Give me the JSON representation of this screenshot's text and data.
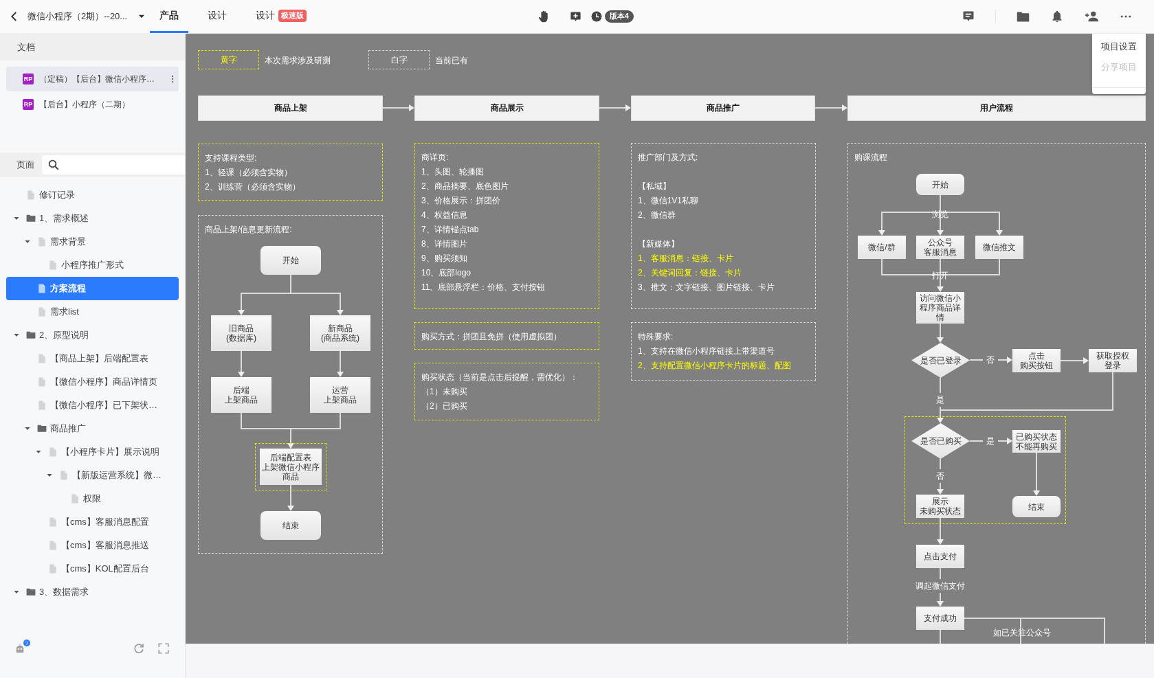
{
  "topbar": {
    "project": "微信小程序（2期）--20...",
    "tabs": [
      {
        "label": "产品",
        "selected": true
      },
      {
        "label": "设计",
        "selected": false
      },
      {
        "label": "设计",
        "selected": false,
        "badge": "极速版"
      }
    ],
    "version": "版本4"
  },
  "menu": [
    {
      "label": "项目设置",
      "disabled": false
    },
    {
      "label": "分享项目",
      "disabled": true
    }
  ],
  "sidebar": {
    "docs_title": "文档",
    "docs": [
      {
        "badge": "RP",
        "label": "（定稿）【后台】微信小程序…",
        "selected": true
      },
      {
        "badge": "RP",
        "label": "【后台】小程序（二期）",
        "selected": false
      }
    ],
    "pages_title": "页面",
    "tree": [
      {
        "kind": "page",
        "label": "修订记录",
        "selected": false
      },
      {
        "kind": "folder",
        "label": "1、需求概述",
        "selected": false,
        "expanded": true,
        "children": [
          {
            "kind": "page",
            "label": "需求背景",
            "selected": false,
            "expanded": true,
            "children": [
              {
                "kind": "page",
                "label": "小程序推广形式",
                "selected": false
              }
            ]
          },
          {
            "kind": "page",
            "label": "方案流程",
            "selected": true
          },
          {
            "kind": "page",
            "label": "需求list",
            "selected": false
          }
        ]
      },
      {
        "kind": "folder",
        "label": "2、原型说明",
        "selected": false,
        "expanded": true,
        "children": [
          {
            "kind": "page",
            "label": "【商品上架】后端配置表",
            "selected": false
          },
          {
            "kind": "page",
            "label": "【微信小程序】商品详情页",
            "selected": false
          },
          {
            "kind": "page",
            "label": "【微信小程序】已下架状…",
            "selected": false
          },
          {
            "kind": "folder",
            "label": "商品推广",
            "selected": false,
            "expanded": true,
            "children": [
              {
                "kind": "page",
                "label": "【小程序卡片】展示说明",
                "selected": false,
                "expanded": true,
                "children": [
                  {
                    "kind": "page",
                    "label": "【新版运营系统】微…",
                    "selected": false,
                    "expanded": true,
                    "children": [
                      {
                        "kind": "page",
                        "label": "权限",
                        "selected": false
                      }
                    ]
                  }
                ]
              },
              {
                "kind": "page",
                "label": "【cms】客服消息配置",
                "selected": false
              },
              {
                "kind": "page",
                "label": "【cms】客服消息推送",
                "selected": false
              },
              {
                "kind": "page",
                "label": "【cms】KOL配置后台",
                "selected": false
              }
            ]
          }
        ]
      },
      {
        "kind": "folder",
        "label": "3、数据需求",
        "selected": false,
        "expanded": true
      }
    ],
    "help_badge": "?"
  },
  "canvas": {
    "legend": [
      {
        "label": "黄字",
        "highlighted": true,
        "text": "本次需求涉及研测"
      },
      {
        "label": "白字",
        "highlighted": false,
        "text": "当前已有"
      }
    ],
    "columns": [
      {
        "header": "商品上架",
        "notes": [
          {
            "highlighted": true,
            "title": "支持课程类型:",
            "lines": [
              {
                "text": "1、轻课（必须含实物）",
                "highlighted": false
              },
              {
                "text": "2、训练营（必须含实物）",
                "highlighted": false
              }
            ]
          },
          {
            "highlighted": false,
            "title": "商品上架/信息更新流程:",
            "flow": {
              "nodes": [
                {
                  "kind": "terminal",
                  "label": "开始"
                },
                {
                  "kind": "process",
                  "lines": [
                    "旧商品",
                    "(数据库)"
                  ]
                },
                {
                  "kind": "process",
                  "lines": [
                    "新商品",
                    "(商品系统)"
                  ]
                },
                {
                  "kind": "process",
                  "lines": [
                    "后端",
                    "上架商品"
                  ]
                },
                {
                  "kind": "process",
                  "lines": [
                    "运营",
                    "上架商品"
                  ]
                },
                {
                  "kind": "process",
                  "lines": [
                    "后端配置表",
                    "上架微信小程序",
                    "商品"
                  ],
                  "highlighted": true
                },
                {
                  "kind": "terminal",
                  "label": "结束"
                }
              ]
            }
          }
        ]
      },
      {
        "header": "商品展示",
        "notes": [
          {
            "highlighted": true,
            "title": "商详页:",
            "lines": [
              {
                "text": "1、头图、轮播图",
                "highlighted": false
              },
              {
                "text": "2、商品摘要、底色图片",
                "highlighted": false
              },
              {
                "text": "3、价格展示：拼团价",
                "highlighted": false
              },
              {
                "text": "4、权益信息",
                "highlighted": false
              },
              {
                "text": "7、详情锚点tab",
                "highlighted": false
              },
              {
                "text": "8、详情图片",
                "highlighted": false
              },
              {
                "text": "9、购买须知",
                "highlighted": false
              },
              {
                "text": "10、底部logo",
                "highlighted": false
              },
              {
                "text": "11、底部悬浮栏：价格、支付按钮",
                "highlighted": false
              }
            ]
          },
          {
            "highlighted": true,
            "title": "购买方式：拼团且免拼（使用虚拟团）"
          },
          {
            "highlighted": true,
            "title": "购买状态（当前是点击后提醒，需优化）：",
            "lines": [
              {
                "text": "（1）未购买",
                "highlighted": false
              },
              {
                "text": "（2）已购买",
                "highlighted": false
              }
            ]
          }
        ]
      },
      {
        "header": "商品推广",
        "notes": [
          {
            "highlighted": false,
            "title": "推广部门及方式:",
            "sections": [
              {
                "heading": "【私域】",
                "lines": [
                  {
                    "text": "1、微信1V1私聊",
                    "highlighted": false
                  },
                  {
                    "text": "2、微信群",
                    "highlighted": false
                  }
                ]
              },
              {
                "heading": "【新媒体】",
                "lines": [
                  {
                    "text": "1、客服消息：链接、卡片",
                    "highlighted": true
                  },
                  {
                    "text": "2、关键词回复：链接、卡片",
                    "highlighted": true
                  },
                  {
                    "text": "3、推文：文字链接、图片链接、卡片",
                    "highlighted": false
                  }
                ]
              }
            ]
          },
          {
            "highlighted": false,
            "title": "特殊要求:",
            "lines": [
              {
                "text": "1、支持在微信小程序链接上带渠道号",
                "highlighted": false
              },
              {
                "text": "2、支持配置微信小程序卡片的标题、配图",
                "highlighted": true
              }
            ]
          }
        ]
      },
      {
        "header": "用户流程",
        "notes": [
          {
            "highlighted": false,
            "title": "购课流程",
            "flow": {
              "highlight_frame": true,
              "nodes": [
                {
                  "kind": "terminal",
                  "label": "开始"
                },
                {
                  "kind": "process",
                  "label": "微信/群"
                },
                {
                  "kind": "process",
                  "lines": [
                    "公众号",
                    "客服消息"
                  ]
                },
                {
                  "kind": "process",
                  "label": "微信推文"
                },
                {
                  "kind": "process",
                  "label": "访问微信小程序商品详情"
                },
                {
                  "kind": "decision",
                  "label": "是否已登录"
                },
                {
                  "kind": "process",
                  "lines": [
                    "点击",
                    "购买按钮"
                  ]
                },
                {
                  "kind": "process",
                  "lines": [
                    "获取授权",
                    "登录"
                  ]
                },
                {
                  "kind": "decision",
                  "label": "是否已购买"
                },
                {
                  "kind": "process",
                  "lines": [
                    "已购买状态",
                    "不能再购买"
                  ]
                },
                {
                  "kind": "process",
                  "lines": [
                    "展示",
                    "未购买状态"
                  ]
                },
                {
                  "kind": "terminal",
                  "label": "结束"
                },
                {
                  "kind": "process",
                  "label": "点击支付"
                },
                {
                  "kind": "process",
                  "label": "支付成功"
                }
              ],
              "edge_labels": [
                "浏览",
                "打开",
                "否",
                "是",
                "是",
                "否",
                "调起微信支付",
                "如已关注公众号"
              ]
            }
          }
        ]
      }
    ]
  }
}
